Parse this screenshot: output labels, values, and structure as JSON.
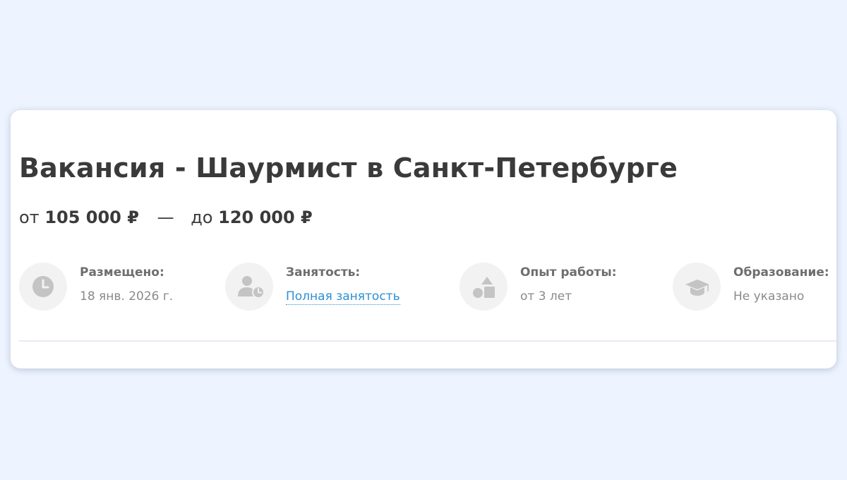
{
  "vacancy": {
    "title": "Вакансия - Шаурмист в Санкт-Петербурге"
  },
  "salary": {
    "from_prefix": "от",
    "from_amount": "105 000 ₽",
    "separator": "—",
    "to_prefix": "до",
    "to_amount": "120 000 ₽"
  },
  "info": {
    "posted": {
      "icon": "clock-icon",
      "label": "Размещено:",
      "value": "18 янв. 2026 г."
    },
    "employment": {
      "icon": "person-clock-icon",
      "label": "Занятость:",
      "value": "Полная занятость"
    },
    "experience": {
      "icon": "shapes-icon",
      "label": "Опыт работы:",
      "value": "от 3 лет"
    },
    "education": {
      "icon": "graduation-cap-icon",
      "label": "Образование:",
      "value": "Не указано"
    }
  },
  "colors": {
    "page_background": "#edf4ff",
    "card_background": "#ffffff",
    "title_text": "#3a3a3a",
    "icon_circle": "#f2f2f2",
    "icon_fill": "#c4c4c4",
    "link": "#2b8fd6"
  }
}
